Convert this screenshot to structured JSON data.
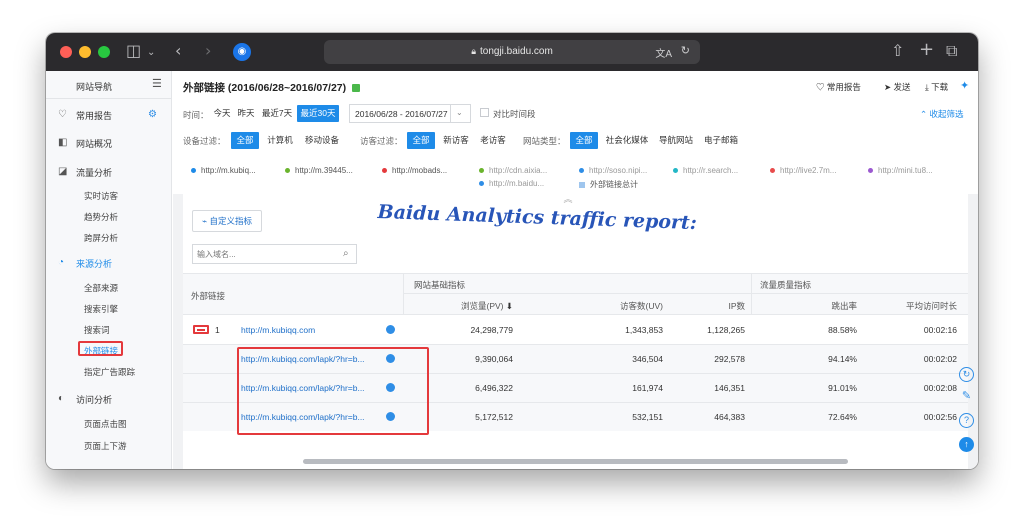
{
  "browser": {
    "url": "tongji.baidu.com"
  },
  "sidebar": {
    "title": "网站导航",
    "items": [
      {
        "label": "常用报告"
      },
      {
        "label": "网站概况"
      },
      {
        "label": "流量分析"
      },
      {
        "label": "来源分析"
      },
      {
        "label": "访问分析"
      }
    ],
    "traffic_sub": [
      "实时访客",
      "趋势分析",
      "跨屏分析"
    ],
    "source_sub": [
      "全部来源",
      "搜索引擎",
      "搜索词",
      "外部链接",
      "指定广告跟踪"
    ],
    "visit_sub": [
      "页面点击图",
      "页面上下游"
    ]
  },
  "header": {
    "title": "外部链接 (2016/06/28~2016/07/27)",
    "actions": [
      "常用报告",
      "发送",
      "下载"
    ]
  },
  "time": {
    "label": "时间：",
    "options": [
      "今天",
      "昨天",
      "最近7天",
      "最近30天"
    ],
    "active": "最近30天",
    "range": "2016/06/28 - 2016/07/27",
    "compare": "对比时间段",
    "collapse": "收起筛选"
  },
  "filters": {
    "device_label": "设备过滤：",
    "device": [
      "全部",
      "计算机",
      "移动设备"
    ],
    "visitor_label": "访客过滤：",
    "visitor": [
      "全部",
      "新访客",
      "老访客"
    ],
    "site_label": "网站类型：",
    "site": [
      "全部",
      "社会化媒体",
      "导航网站",
      "电子邮箱"
    ]
  },
  "legend": {
    "row1": [
      "http://m.kubiq...",
      "http://m.39445...",
      "http://mobads...",
      "http://cdn.aixia...",
      "http://soso.nipi...",
      "http://r.search...",
      "http://live2.7m...",
      "http://mini.tu8..."
    ],
    "row2": [
      "http://m.baidu...",
      "外部链接总计"
    ],
    "colors": [
      "#1e8be8",
      "#6ab42d",
      "#e4393c",
      "#6ab42d",
      "#2f8ee6",
      "#23b7c6",
      "#e84b4b",
      "#9b59d0",
      "#2f8ee6",
      "#9fc6ee"
    ]
  },
  "overlay": {
    "caption": "Baidu Analytics traffic report:"
  },
  "custom_metric": "自定义指标",
  "search": {
    "placeholder": "输入域名..."
  },
  "table": {
    "col_main": "外部链接",
    "group1": "网站基础指标",
    "group2": "流量质量指标",
    "cols": [
      "浏览量(PV)",
      "访客数(UV)",
      "IP数",
      "跳出率",
      "平均访问时长"
    ],
    "rows": [
      {
        "index": "1",
        "url": "http://m.kubiqq.com",
        "pv": "24,298,779",
        "uv": "1,343,853",
        "ip": "1,128,265",
        "bounce": "88.58%",
        "dur": "00:02:16"
      },
      {
        "index": "",
        "url": "http://m.kubiqq.com/lapk/?hr=b...",
        "pv": "9,390,064",
        "uv": "346,504",
        "ip": "292,578",
        "bounce": "94.14%",
        "dur": "00:02:02"
      },
      {
        "index": "",
        "url": "http://m.kubiqq.com/lapk/?hr=b...",
        "pv": "6,496,322",
        "uv": "161,974",
        "ip": "146,351",
        "bounce": "91.01%",
        "dur": "00:02:08"
      },
      {
        "index": "",
        "url": "http://m.kubiqq.com/lapk/?hr=b...",
        "pv": "5,172,512",
        "uv": "532,151",
        "ip": "464,383",
        "bounce": "72.64%",
        "dur": "00:02:56"
      }
    ]
  },
  "colors": {
    "accent": "#1e8be8",
    "highlight": "#e4393c",
    "titlebar": "#2b2a2d"
  }
}
